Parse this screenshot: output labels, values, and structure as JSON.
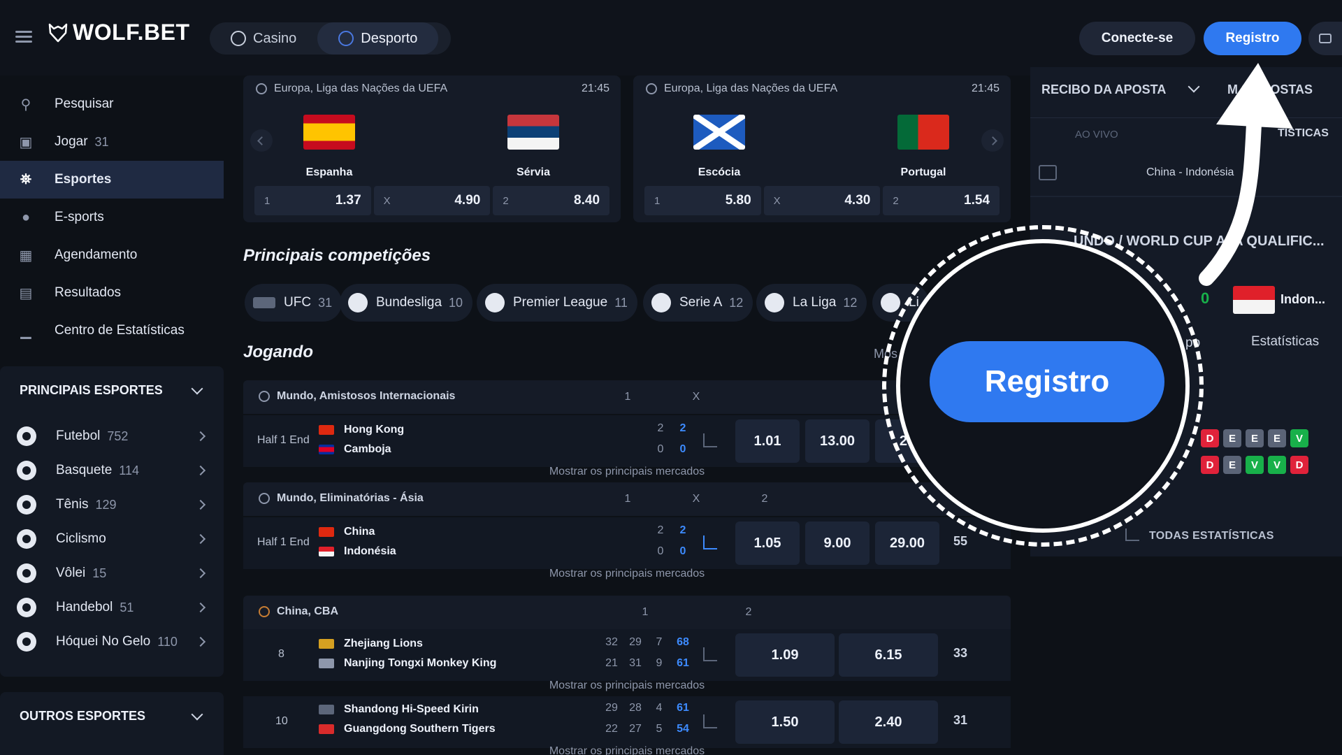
{
  "header": {
    "logo_text": "WOLF.BET",
    "modes": [
      {
        "label": "Casino",
        "icon": "casino-icon"
      },
      {
        "label": "Desporto",
        "icon": "soccer-ball-icon",
        "active": true
      }
    ],
    "login_label": "Conecte-se",
    "register_label": "Registro",
    "chat_icon": "chat-icon"
  },
  "sidebar": {
    "nav": [
      {
        "label": "Pesquisar",
        "icon": "search-icon",
        "count": ""
      },
      {
        "label": "Jogar",
        "icon": "live-icon",
        "count": "31"
      },
      {
        "label": "Esportes",
        "icon": "trophy-icon",
        "count": "",
        "active": true
      },
      {
        "label": "E-sports",
        "icon": "gamepad-icon",
        "count": ""
      },
      {
        "label": "Agendamento",
        "icon": "calendar-icon",
        "count": ""
      },
      {
        "label": "Resultados",
        "icon": "results-icon",
        "count": ""
      },
      {
        "label": "Centro de Estatísticas",
        "icon": "stats-icon",
        "count": ""
      }
    ],
    "main_sports_title": "PRINCIPAIS ESPORTES",
    "sports": [
      {
        "label": "Futebol",
        "count": "752",
        "icon": "soccer-icon"
      },
      {
        "label": "Basquete",
        "count": "114",
        "icon": "basketball-icon"
      },
      {
        "label": "Tênis",
        "count": "129",
        "icon": "tennis-icon"
      },
      {
        "label": "Ciclismo",
        "count": "",
        "icon": "cycling-icon"
      },
      {
        "label": "Vôlei",
        "count": "15",
        "icon": "volleyball-icon"
      },
      {
        "label": "Handebol",
        "count": "51",
        "icon": "handball-icon"
      },
      {
        "label": "Hóquei No Gelo",
        "count": "110",
        "icon": "ice-hockey-icon"
      }
    ],
    "other_sports_title": "OUTROS ESPORTES"
  },
  "featured": [
    {
      "competition": "Europa, Liga das Nações da UEFA",
      "time": "21:45",
      "home": "Espanha",
      "away": "Sérvia",
      "odds": [
        {
          "label": "1",
          "value": "1.37"
        },
        {
          "label": "X",
          "value": "4.90"
        },
        {
          "label": "2",
          "value": "8.40"
        }
      ]
    },
    {
      "competition": "Europa, Liga das Nações da UEFA",
      "time": "21:45",
      "home": "Escócia",
      "away": "Portugal",
      "odds": [
        {
          "label": "1",
          "value": "5.80"
        },
        {
          "label": "X",
          "value": "4.30"
        },
        {
          "label": "2",
          "value": "1.54"
        }
      ]
    }
  ],
  "competitions_title": "Principais competições",
  "competitions": [
    {
      "label": "UFC",
      "count": "31"
    },
    {
      "label": "Bundesliga",
      "count": "10"
    },
    {
      "label": "Premier League",
      "count": "11"
    },
    {
      "label": "Serie A",
      "count": "12"
    },
    {
      "label": "La Liga",
      "count": "12"
    },
    {
      "label": "Li",
      "count": ""
    }
  ],
  "live_title": "Jogando",
  "show_more": "Mos",
  "market_link": "Mostrar os principais mercados",
  "groups": [
    {
      "name": "Mundo, Amistosos Internacionais",
      "cols": [
        "1",
        "X"
      ],
      "match": {
        "status": "Half 1 End",
        "home": "Hong Kong",
        "away": "Camboja",
        "home_scores": [
          "2"
        ],
        "away_scores": [
          "0"
        ],
        "home_total": "2",
        "away_total": "0",
        "odds": [
          "1.01",
          "13.00",
          "29"
        ],
        "more": ""
      }
    },
    {
      "name": "Mundo, Eliminatórias - Ásia",
      "cols": [
        "1",
        "X",
        "2"
      ],
      "match": {
        "status": "Half 1 End",
        "home": "China",
        "away": "Indonésia",
        "home_scores": [
          "2"
        ],
        "away_scores": [
          "0"
        ],
        "home_total": "2",
        "away_total": "0",
        "odds": [
          "1.05",
          "9.00",
          "29.00"
        ],
        "more": "55"
      }
    },
    {
      "name": "China, CBA",
      "cols": [
        "1",
        "2"
      ],
      "matches": [
        {
          "status": "8",
          "home": "Zhejiang Lions",
          "away": "Nanjing Tongxi Monkey King",
          "home_scores": [
            "32",
            "29",
            "7"
          ],
          "away_scores": [
            "21",
            "31",
            "9"
          ],
          "home_total": "68",
          "away_total": "61",
          "odds": [
            "1.09",
            "6.15"
          ],
          "more": "33"
        },
        {
          "status": "10",
          "home": "Shandong Hi-Speed Kirin",
          "away": "Guangdong Southern Tigers",
          "home_scores": [
            "29",
            "28",
            "4"
          ],
          "away_scores": [
            "22",
            "27",
            "5"
          ],
          "home_total": "61",
          "away_total": "54",
          "odds": [
            "1.50",
            "2.40"
          ],
          "more": "31"
        }
      ]
    }
  ],
  "right_panel": {
    "receipt_title": "RECIBO DA APOSTA",
    "my_bets_title": "M  S APOSTAS",
    "live_label": "AO VIVO",
    "stats_tab": "TÍSTICAS",
    "match_label": "China - Indonésia",
    "league_label": "UNDO / WORLD CUP A IA QUALIFIC...",
    "score": "0",
    "team": "Indon...",
    "field_label": "po",
    "stats_label": "Estatísticas",
    "form_rows": [
      [
        "D",
        "E",
        "E",
        "E",
        "V"
      ],
      [
        "D",
        "E",
        "V",
        "V",
        "D"
      ]
    ],
    "all_stats": "TODAS ESTATÍSTICAS"
  },
  "magnifier": {
    "label": "Registro"
  },
  "colors": {
    "background": "#0d1117",
    "accent_blue": "#2f79f0",
    "live_score_blue": "#3d8bff",
    "form_loss": "#e0223a",
    "form_draw": "#5b6477",
    "form_win": "#18b04a"
  }
}
